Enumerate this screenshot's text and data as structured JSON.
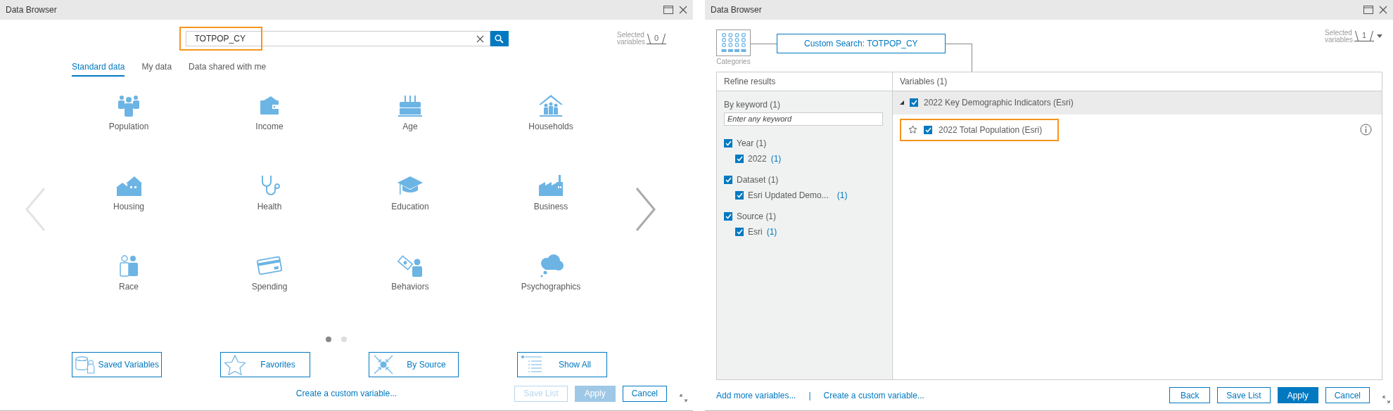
{
  "browse_window": {
    "title": "Data Browser",
    "search": {
      "value": "TOTPOP_CY",
      "highlighted": true
    },
    "selected_variables": {
      "label": "Selected variables",
      "count": "0"
    },
    "tabs": [
      {
        "label": "Standard data",
        "selected": true
      },
      {
        "label": "My data",
        "selected": false
      },
      {
        "label": "Data shared with me",
        "selected": false
      }
    ],
    "carousel": {
      "prev_disabled": true,
      "next_disabled": false
    },
    "categories": [
      {
        "label": "Population"
      },
      {
        "label": "Income"
      },
      {
        "label": "Age"
      },
      {
        "label": "Households"
      },
      {
        "label": "Housing"
      },
      {
        "label": "Health"
      },
      {
        "label": "Education"
      },
      {
        "label": "Business"
      },
      {
        "label": "Race"
      },
      {
        "label": "Spending"
      },
      {
        "label": "Behaviors"
      },
      {
        "label": "Psychographics"
      }
    ],
    "page_dots": [
      {
        "selected": true
      },
      {
        "selected": false
      }
    ],
    "shortcuts": [
      {
        "label": "Saved Variables"
      },
      {
        "label": "Favorites"
      },
      {
        "label": "By Source"
      },
      {
        "label": "Show All"
      }
    ],
    "link": "Create a custom variable...",
    "buttons": [
      {
        "label": "Save List",
        "disabled": true,
        "primary": false
      },
      {
        "label": "Apply",
        "disabled": true,
        "primary": true
      },
      {
        "label": "Cancel",
        "disabled": false,
        "primary": false
      }
    ]
  },
  "results_window": {
    "title": "Data Browser",
    "breadcrumb": {
      "categories_label": "Categories",
      "crumb": "Custom Search: TOTPOP_CY"
    },
    "selected_variables": {
      "label": "Selected variables",
      "count": "1"
    },
    "refine": {
      "header": "Refine results",
      "keyword_label": "By keyword (1)",
      "keyword_placeholder": "Enter any keyword",
      "groups": [
        {
          "label": "Year",
          "count": "(1)",
          "checked": true,
          "children": [
            {
              "label": "2022",
              "count": "(1)",
              "checked": true
            }
          ]
        },
        {
          "label": "Dataset",
          "count": "(1)",
          "checked": true,
          "children": [
            {
              "label": "Esri Updated Demo...",
              "count": "(1)",
              "checked": true
            }
          ]
        },
        {
          "label": "Source",
          "count": "(1)",
          "checked": true,
          "children": [
            {
              "label": "Esri",
              "count": "(1)",
              "checked": true
            }
          ]
        }
      ]
    },
    "variables": {
      "header": "Variables (1)",
      "groups": [
        {
          "label": "2022 Key Demographic Indicators (Esri)",
          "checked": true,
          "expanded": true,
          "items": [
            {
              "label": "2022 Total Population (Esri)",
              "checked": true,
              "favorite": false,
              "highlighted": true
            }
          ]
        }
      ]
    },
    "footer_links": [
      "Add more variables...",
      "|",
      "Create a custom variable..."
    ],
    "buttons": [
      {
        "label": "Back",
        "disabled": false,
        "primary": false
      },
      {
        "label": "Save List",
        "disabled": false,
        "primary": false
      },
      {
        "label": "Apply",
        "disabled": false,
        "primary": true
      },
      {
        "label": "Cancel",
        "disabled": false,
        "primary": false
      }
    ]
  }
}
